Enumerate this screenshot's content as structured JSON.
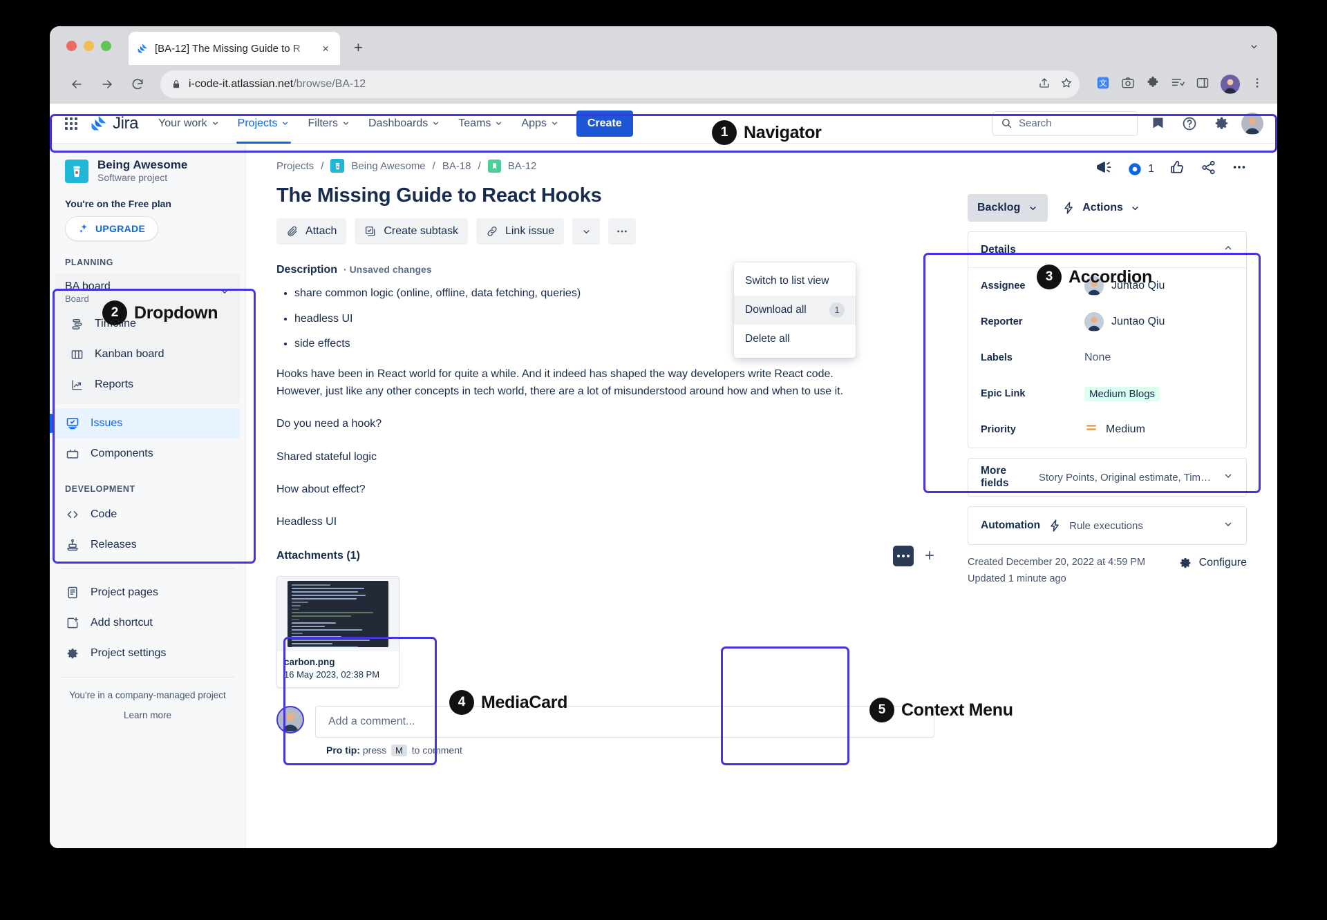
{
  "browser": {
    "tab_title": "[BA-12] The Missing Guide to R",
    "tab_close": "×",
    "new_tab": "+",
    "url_main": "i-code-it.atlassian.net",
    "url_path": "/browse/BA-12"
  },
  "topnav": {
    "logo_text": "Jira",
    "items": [
      {
        "label": "Your work",
        "caret": "⌄"
      },
      {
        "label": "Projects",
        "caret": "⌄"
      },
      {
        "label": "Filters",
        "caret": "⌄"
      },
      {
        "label": "Dashboards",
        "caret": "⌄"
      },
      {
        "label": "Teams",
        "caret": "⌄"
      },
      {
        "label": "Apps",
        "caret": "⌄"
      }
    ],
    "create_label": "Create",
    "search_placeholder": "Search"
  },
  "sidebar": {
    "project_name": "Being Awesome",
    "project_type": "Software project",
    "plan_note": "You're on the Free plan",
    "upgrade_label": "UPGRADE",
    "planning_label": "PLANNING",
    "board_name": "BA board",
    "board_kind": "Board",
    "board_items": [
      {
        "label": "Timeline",
        "icon": "timeline-icon"
      },
      {
        "label": "Kanban board",
        "icon": "board-icon"
      },
      {
        "label": "Reports",
        "icon": "reports-icon"
      }
    ],
    "items": [
      {
        "label": "Issues",
        "icon": "issues-icon",
        "selected": true
      },
      {
        "label": "Components",
        "icon": "components-icon",
        "selected": false
      }
    ],
    "development_label": "DEVELOPMENT",
    "dev_items": [
      {
        "label": "Code",
        "icon": "code-icon"
      },
      {
        "label": "Releases",
        "icon": "releases-icon"
      }
    ],
    "extra_items": [
      {
        "label": "Project pages",
        "icon": "page-icon"
      },
      {
        "label": "Add shortcut",
        "icon": "add-shortcut-icon"
      },
      {
        "label": "Project settings",
        "icon": "gear-icon"
      }
    ],
    "footer_note": "You're in a company-managed project",
    "footer_link": "Learn more"
  },
  "content": {
    "breadcrumbs": [
      "Projects",
      "Being Awesome",
      "BA-18",
      "BA-12"
    ],
    "title": "The Missing Guide to React Hooks",
    "actions": [
      {
        "label": "Attach",
        "icon": "paperclip-icon"
      },
      {
        "label": "Create subtask",
        "icon": "subtask-icon"
      },
      {
        "label": "Link issue",
        "icon": "link-icon"
      }
    ],
    "action_caret": "⌄",
    "action_more": "···",
    "description_label": "Description",
    "unsaved_label": "· Unsaved changes",
    "bullets": [
      "share common logic (online, offline, data fetching, queries)",
      "headless UI",
      "side effects"
    ],
    "paragraphs": [
      "Hooks have been in React world for quite a while. And it indeed has shaped the way developers write React code. However, just like any other concepts in tech world, there are a lot of misunderstood around how and when to use it.",
      "Do you need a hook?",
      "Shared stateful logic",
      "How about effect?",
      "Headless UI"
    ],
    "attachments_label": "Attachments (1)",
    "attachment": {
      "name": "carbon.png",
      "date": "16 May 2023, 02:38 PM"
    },
    "comment_placeholder": "Add a comment...",
    "protip_prefix": "Pro tip:",
    "protip_mid": "press",
    "protip_key": "M",
    "protip_suffix": "to comment"
  },
  "context_menu": {
    "items": [
      {
        "label": "Switch to list view",
        "badge": ""
      },
      {
        "label": "Download all",
        "badge": "1"
      },
      {
        "label": "Delete all",
        "badge": ""
      }
    ]
  },
  "right_panel": {
    "watch_count": "1",
    "status_label": "Backlog",
    "status_caret": "⌄",
    "actions_label": "Actions",
    "actions_caret": "⌄",
    "details_label": "Details",
    "details_chevron": "⌃",
    "fields": [
      {
        "label": "Assignee",
        "value": "Juntao Qiu",
        "kind": "avatar"
      },
      {
        "label": "Reporter",
        "value": "Juntao Qiu",
        "kind": "avatar"
      },
      {
        "label": "Labels",
        "value": "None",
        "kind": "text"
      },
      {
        "label": "Epic Link",
        "value": "Medium Blogs",
        "kind": "lozenge"
      },
      {
        "label": "Priority",
        "value": "Medium",
        "kind": "priority"
      }
    ],
    "more_fields_label": "More fields",
    "more_fields_sub": "Story Points, Original estimate, Time trac…",
    "more_fields_caret": "⌄",
    "automation_label": "Automation",
    "automation_sub": "Rule executions",
    "automation_caret": "⌄",
    "created_text": "Created December 20, 2022 at 4:59 PM",
    "updated_text": "Updated 1 minute ago",
    "configure_label": "Configure"
  },
  "annotations": [
    {
      "num": "1",
      "label": "Navigator"
    },
    {
      "num": "2",
      "label": "Dropdown"
    },
    {
      "num": "3",
      "label": "Accordion"
    },
    {
      "num": "4",
      "label": "MediaCard"
    },
    {
      "num": "5",
      "label": "Context Menu"
    }
  ],
  "colors": {
    "accent": "#0c66e4",
    "create": "#1d57d6",
    "annotation": "#4434e0",
    "lozenge": "#dcfff1",
    "priority": "#e2953e"
  }
}
